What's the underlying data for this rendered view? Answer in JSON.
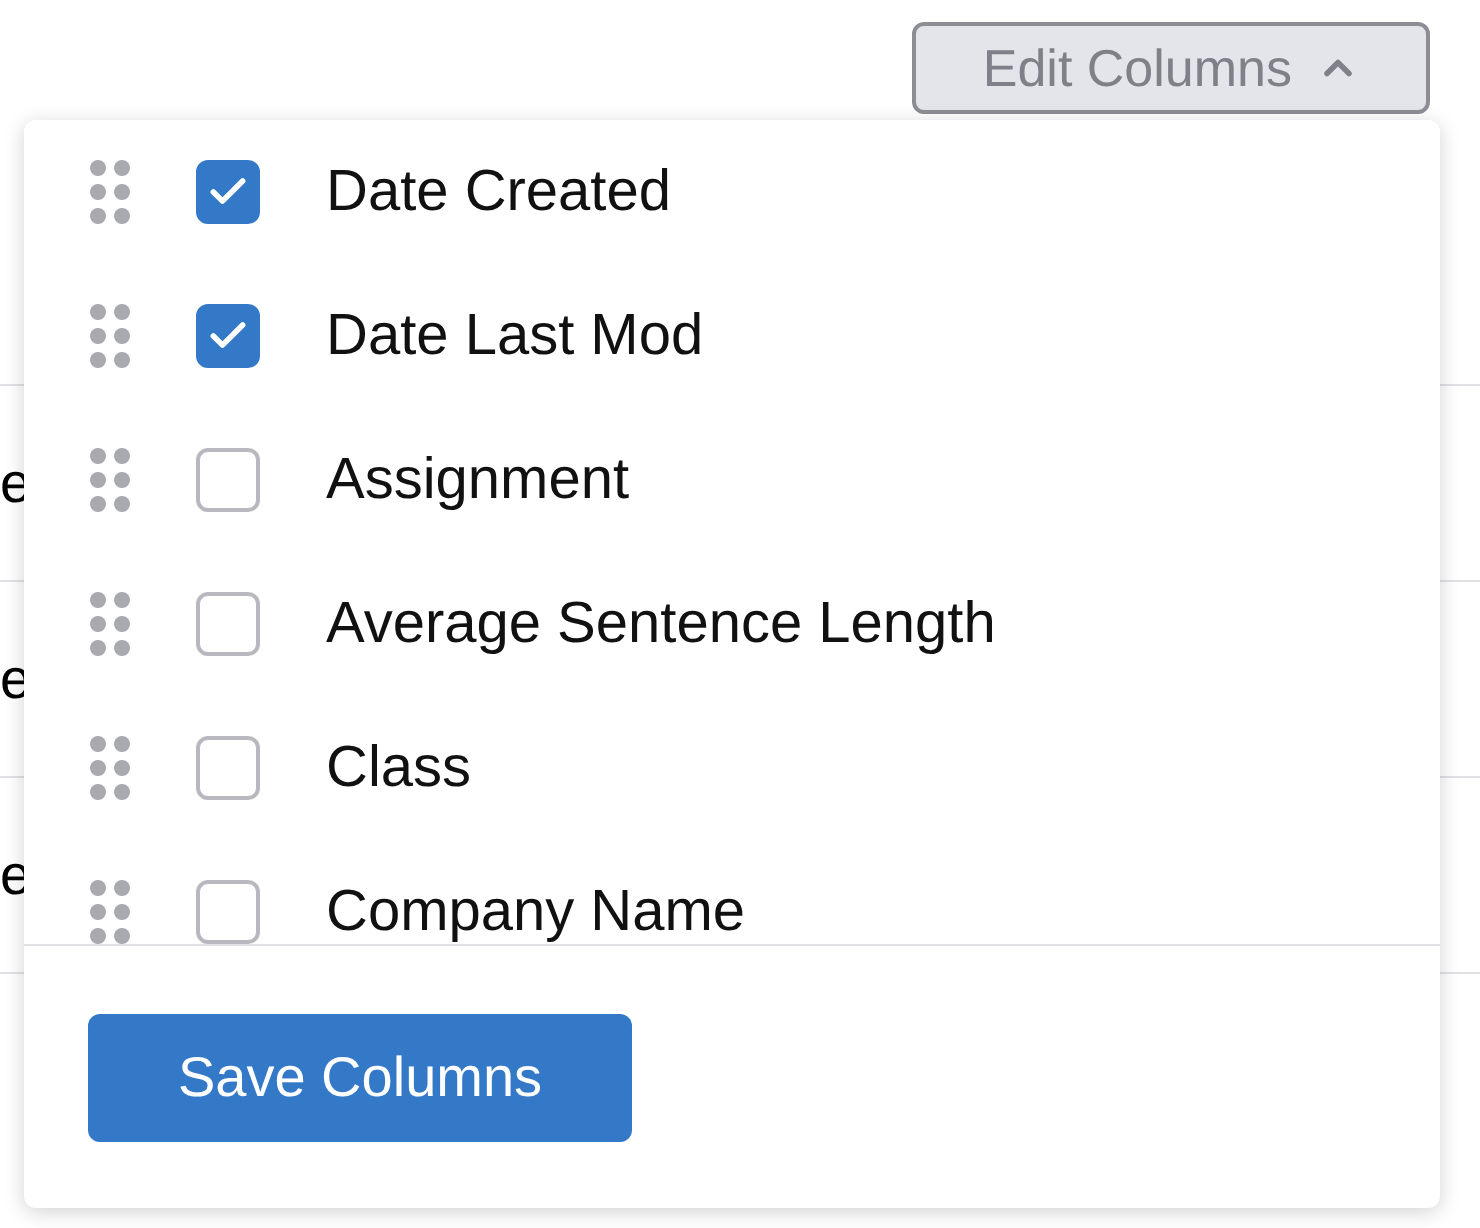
{
  "toolbar": {
    "edit_columns": {
      "label": "Edit Columns",
      "expanded": true
    }
  },
  "table_rows": [
    {
      "text": "e"
    },
    {
      "text": "e"
    },
    {
      "text": "e"
    }
  ],
  "column_menu": {
    "items": [
      {
        "label": "Date Created",
        "checked": true
      },
      {
        "label": "Date Last Mod",
        "checked": true
      },
      {
        "label": "Assignment",
        "checked": false
      },
      {
        "label": "Average Sentence Length",
        "checked": false
      },
      {
        "label": "Class",
        "checked": false
      },
      {
        "label": "Company Name",
        "checked": false
      }
    ],
    "save_button": "Save Columns"
  }
}
